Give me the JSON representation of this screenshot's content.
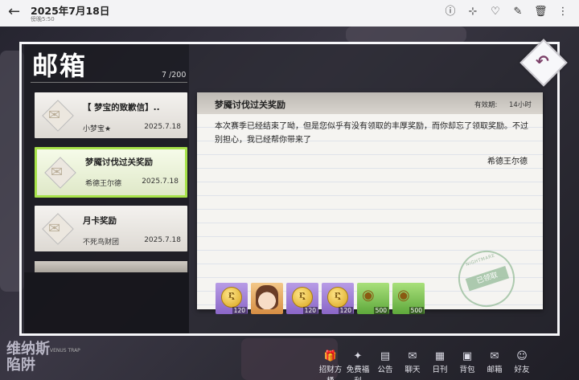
{
  "viewer": {
    "back_icon": "arrow-left-icon",
    "date": "2025年7月18日",
    "time": "傍晚5:50",
    "actions": [
      {
        "name": "info-icon",
        "glyph": "ⓘ"
      },
      {
        "name": "share-icon",
        "glyph": "⊹"
      },
      {
        "name": "favorite-icon",
        "glyph": "♡"
      },
      {
        "name": "edit-icon",
        "glyph": "✎"
      },
      {
        "name": "delete-icon",
        "glyph": "🗑"
      },
      {
        "name": "more-icon",
        "glyph": "⋮"
      }
    ]
  },
  "mailbox": {
    "title": "邮箱",
    "count": "7 /200",
    "mails": [
      {
        "title": "【 梦宝的致歉信】..",
        "sender": "小梦宝★",
        "date": "2025.7.18"
      },
      {
        "title": "梦魇讨伐过关奖励",
        "sender": "希德王尔德",
        "date": "2025.7.18"
      },
      {
        "title": "月卡奖励",
        "sender": "不死鸟财团",
        "date": "2025.7.18"
      }
    ]
  },
  "detail": {
    "title": "梦魇讨伐过关奖励",
    "expire_label": "有效期:",
    "expire_value": "14小时",
    "body": "本次赛季已经结束了呦，但是您似乎有没有领取的丰厚奖励，而你却忘了领取奖励。不过别担心，我已经帮你带来了",
    "signature": "希德王尔德",
    "rewards": [
      {
        "kind": "coin",
        "color": "purple",
        "glyph": "Ⴀ",
        "qty": "120"
      },
      {
        "kind": "avatar",
        "color": "orange",
        "glyph": "",
        "qty": ""
      },
      {
        "kind": "coin",
        "color": "purple",
        "glyph": "Ⴀ",
        "qty": "120"
      },
      {
        "kind": "coin",
        "color": "purple",
        "glyph": "Ⴀ",
        "qty": "120"
      },
      {
        "kind": "gold",
        "color": "green",
        "glyph": "◉",
        "qty": "500"
      },
      {
        "kind": "gold",
        "color": "green",
        "glyph": "◉",
        "qty": "500"
      }
    ],
    "stamp_ring": "NIGHTMARE",
    "stamp_text": "已领取"
  },
  "background": {
    "title_left": "维纳斯\n陷阱",
    "subtitle_left": "VENUS TRAP"
  },
  "game_nav": [
    {
      "icon": "gift-icon",
      "glyph": "🎁",
      "label": "招财方桶"
    },
    {
      "icon": "welfare-icon",
      "glyph": "✦",
      "label": "免费福利"
    },
    {
      "icon": "notice-icon",
      "glyph": "▤",
      "label": "公告"
    },
    {
      "icon": "chat-icon",
      "glyph": "✉",
      "label": "聊天"
    },
    {
      "icon": "calendar-icon",
      "glyph": "▦",
      "label": "日刊"
    },
    {
      "icon": "bag-icon",
      "glyph": "▣",
      "label": "背包"
    },
    {
      "icon": "mail-icon",
      "glyph": "✉",
      "label": "邮箱"
    },
    {
      "icon": "friends-icon",
      "glyph": "☺",
      "label": "好友"
    }
  ],
  "colors": {
    "active_border": "#a7e34a",
    "back_arrow": "#7b3f68"
  }
}
